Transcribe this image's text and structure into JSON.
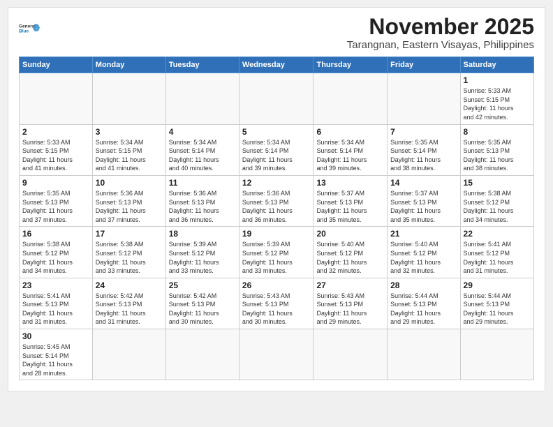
{
  "header": {
    "month_year": "November 2025",
    "location": "Tarangnan, Eastern Visayas, Philippines",
    "logo_line1": "General",
    "logo_line2": "Blue"
  },
  "weekdays": [
    "Sunday",
    "Monday",
    "Tuesday",
    "Wednesday",
    "Thursday",
    "Friday",
    "Saturday"
  ],
  "days": [
    {
      "date": "",
      "info": ""
    },
    {
      "date": "",
      "info": ""
    },
    {
      "date": "",
      "info": ""
    },
    {
      "date": "",
      "info": ""
    },
    {
      "date": "",
      "info": ""
    },
    {
      "date": "",
      "info": ""
    },
    {
      "date": "1",
      "info": "Sunrise: 5:33 AM\nSunset: 5:15 PM\nDaylight: 11 hours\nand 42 minutes."
    },
    {
      "date": "2",
      "info": "Sunrise: 5:33 AM\nSunset: 5:15 PM\nDaylight: 11 hours\nand 41 minutes."
    },
    {
      "date": "3",
      "info": "Sunrise: 5:34 AM\nSunset: 5:15 PM\nDaylight: 11 hours\nand 41 minutes."
    },
    {
      "date": "4",
      "info": "Sunrise: 5:34 AM\nSunset: 5:14 PM\nDaylight: 11 hours\nand 40 minutes."
    },
    {
      "date": "5",
      "info": "Sunrise: 5:34 AM\nSunset: 5:14 PM\nDaylight: 11 hours\nand 39 minutes."
    },
    {
      "date": "6",
      "info": "Sunrise: 5:34 AM\nSunset: 5:14 PM\nDaylight: 11 hours\nand 39 minutes."
    },
    {
      "date": "7",
      "info": "Sunrise: 5:35 AM\nSunset: 5:14 PM\nDaylight: 11 hours\nand 38 minutes."
    },
    {
      "date": "8",
      "info": "Sunrise: 5:35 AM\nSunset: 5:13 PM\nDaylight: 11 hours\nand 38 minutes."
    },
    {
      "date": "9",
      "info": "Sunrise: 5:35 AM\nSunset: 5:13 PM\nDaylight: 11 hours\nand 37 minutes."
    },
    {
      "date": "10",
      "info": "Sunrise: 5:36 AM\nSunset: 5:13 PM\nDaylight: 11 hours\nand 37 minutes."
    },
    {
      "date": "11",
      "info": "Sunrise: 5:36 AM\nSunset: 5:13 PM\nDaylight: 11 hours\nand 36 minutes."
    },
    {
      "date": "12",
      "info": "Sunrise: 5:36 AM\nSunset: 5:13 PM\nDaylight: 11 hours\nand 36 minutes."
    },
    {
      "date": "13",
      "info": "Sunrise: 5:37 AM\nSunset: 5:13 PM\nDaylight: 11 hours\nand 35 minutes."
    },
    {
      "date": "14",
      "info": "Sunrise: 5:37 AM\nSunset: 5:13 PM\nDaylight: 11 hours\nand 35 minutes."
    },
    {
      "date": "15",
      "info": "Sunrise: 5:38 AM\nSunset: 5:12 PM\nDaylight: 11 hours\nand 34 minutes."
    },
    {
      "date": "16",
      "info": "Sunrise: 5:38 AM\nSunset: 5:12 PM\nDaylight: 11 hours\nand 34 minutes."
    },
    {
      "date": "17",
      "info": "Sunrise: 5:38 AM\nSunset: 5:12 PM\nDaylight: 11 hours\nand 33 minutes."
    },
    {
      "date": "18",
      "info": "Sunrise: 5:39 AM\nSunset: 5:12 PM\nDaylight: 11 hours\nand 33 minutes."
    },
    {
      "date": "19",
      "info": "Sunrise: 5:39 AM\nSunset: 5:12 PM\nDaylight: 11 hours\nand 33 minutes."
    },
    {
      "date": "20",
      "info": "Sunrise: 5:40 AM\nSunset: 5:12 PM\nDaylight: 11 hours\nand 32 minutes."
    },
    {
      "date": "21",
      "info": "Sunrise: 5:40 AM\nSunset: 5:12 PM\nDaylight: 11 hours\nand 32 minutes."
    },
    {
      "date": "22",
      "info": "Sunrise: 5:41 AM\nSunset: 5:12 PM\nDaylight: 11 hours\nand 31 minutes."
    },
    {
      "date": "23",
      "info": "Sunrise: 5:41 AM\nSunset: 5:13 PM\nDaylight: 11 hours\nand 31 minutes."
    },
    {
      "date": "24",
      "info": "Sunrise: 5:42 AM\nSunset: 5:13 PM\nDaylight: 11 hours\nand 31 minutes."
    },
    {
      "date": "25",
      "info": "Sunrise: 5:42 AM\nSunset: 5:13 PM\nDaylight: 11 hours\nand 30 minutes."
    },
    {
      "date": "26",
      "info": "Sunrise: 5:43 AM\nSunset: 5:13 PM\nDaylight: 11 hours\nand 30 minutes."
    },
    {
      "date": "27",
      "info": "Sunrise: 5:43 AM\nSunset: 5:13 PM\nDaylight: 11 hours\nand 29 minutes."
    },
    {
      "date": "28",
      "info": "Sunrise: 5:44 AM\nSunset: 5:13 PM\nDaylight: 11 hours\nand 29 minutes."
    },
    {
      "date": "29",
      "info": "Sunrise: 5:44 AM\nSunset: 5:13 PM\nDaylight: 11 hours\nand 29 minutes."
    },
    {
      "date": "30",
      "info": "Sunrise: 5:45 AM\nSunset: 5:14 PM\nDaylight: 11 hours\nand 28 minutes."
    },
    {
      "date": "",
      "info": ""
    },
    {
      "date": "",
      "info": ""
    },
    {
      "date": "",
      "info": ""
    },
    {
      "date": "",
      "info": ""
    },
    {
      "date": "",
      "info": ""
    },
    {
      "date": "",
      "info": ""
    }
  ]
}
